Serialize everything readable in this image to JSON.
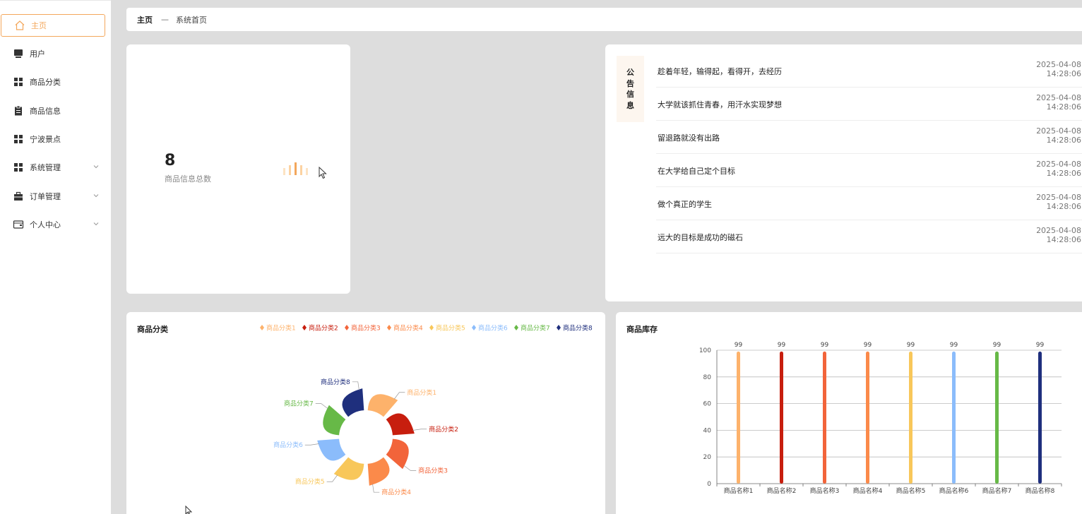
{
  "sidebar": {
    "items": [
      {
        "label": "主页",
        "icon": "home-icon",
        "active": true,
        "expandable": false
      },
      {
        "label": "用户",
        "icon": "monitor-icon",
        "active": false,
        "expandable": false
      },
      {
        "label": "商品分类",
        "icon": "grid-icon",
        "active": false,
        "expandable": false
      },
      {
        "label": "商品信息",
        "icon": "clipboard-icon",
        "active": false,
        "expandable": false
      },
      {
        "label": "宁波景点",
        "icon": "grid-icon",
        "active": false,
        "expandable": false
      },
      {
        "label": "系统管理",
        "icon": "grid-icon",
        "active": false,
        "expandable": true
      },
      {
        "label": "订单管理",
        "icon": "briefcase-icon",
        "active": false,
        "expandable": true
      },
      {
        "label": "个人中心",
        "icon": "wallet-icon",
        "active": false,
        "expandable": true
      }
    ]
  },
  "breadcrumb": {
    "home": "主页",
    "separator": "—",
    "current": "系统首页"
  },
  "stat": {
    "value": "8",
    "caption": "商品信息总数"
  },
  "notice": {
    "tag": [
      "公",
      "告",
      "信",
      "息"
    ],
    "rows": [
      {
        "title": "趁着年轻，输得起，看得开，去经历",
        "date": "2025-04-08",
        "time": "14:28:06"
      },
      {
        "title": "大学就该抓住青春，用汗水实现梦想",
        "date": "2025-04-08",
        "time": "14:28:06"
      },
      {
        "title": "留退路就没有出路",
        "date": "2025-04-08",
        "time": "14:28:06"
      },
      {
        "title": "在大学给自己定个目标",
        "date": "2025-04-08",
        "time": "14:28:06"
      },
      {
        "title": "做个真正的学生",
        "date": "2025-04-08",
        "time": "14:28:06"
      },
      {
        "title": "远大的目标是成功的磁石",
        "date": "2025-04-08",
        "time": "14:28:06"
      }
    ]
  },
  "colors": {
    "accent": "#f3a75c",
    "series": [
      "#fdb26b",
      "#c71e0e",
      "#f2643a",
      "#fb8a4a",
      "#f8c75a",
      "#8bbcfb",
      "#67b947",
      "#1f2f7d"
    ]
  },
  "chart_data": [
    {
      "type": "pie",
      "title": "商品分类",
      "legend_position": "top-right",
      "categories": [
        "商品分类1",
        "商品分类2",
        "商品分类3",
        "商品分类4",
        "商品分类5",
        "商品分类6",
        "商品分类7",
        "商品分类8"
      ],
      "values": [
        1,
        1,
        1,
        1,
        1,
        1,
        1,
        1
      ]
    },
    {
      "type": "bar",
      "title": "商品库存",
      "categories": [
        "商品名称1",
        "商品名称2",
        "商品名称3",
        "商品名称4",
        "商品名称5",
        "商品名称6",
        "商品名称7",
        "商品名称8"
      ],
      "values": [
        99,
        99,
        99,
        99,
        99,
        99,
        99,
        99
      ],
      "ylim": [
        0,
        100
      ],
      "yticks": [
        0,
        20,
        40,
        60,
        80,
        100
      ],
      "grid": true,
      "data_labels": true
    }
  ]
}
